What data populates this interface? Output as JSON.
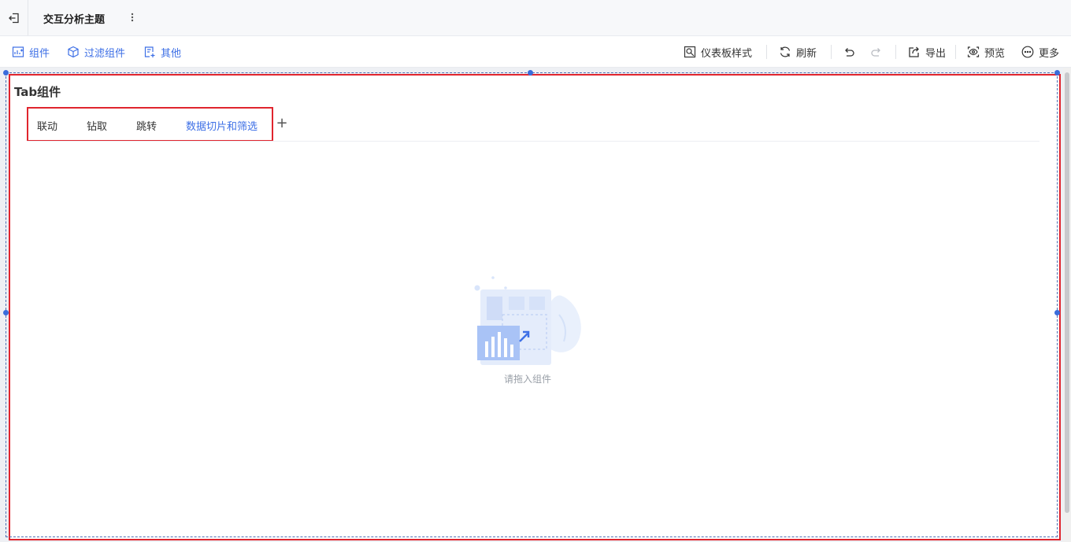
{
  "header": {
    "title": "交互分析主题",
    "back_icon": "exit-icon",
    "more_icon": "vertical-ellipsis-icon"
  },
  "toolbar": {
    "left": [
      {
        "label": "组件",
        "icon": "chart-add-icon"
      },
      {
        "label": "过滤组件",
        "icon": "filter-cube-icon"
      },
      {
        "label": "其他",
        "icon": "document-add-icon"
      }
    ],
    "right": [
      {
        "label": "仪表板样式",
        "icon": "dashboard-style-icon"
      },
      {
        "label": "刷新",
        "icon": "refresh-icon"
      },
      {
        "label": "导出",
        "icon": "export-icon"
      },
      {
        "label": "预览",
        "icon": "preview-icon"
      },
      {
        "label": "更多",
        "icon": "more-circle-icon"
      }
    ],
    "undo_icon": "undo-icon",
    "redo_icon": "redo-icon"
  },
  "component": {
    "title": "Tab组件",
    "tabs": [
      {
        "label": "联动",
        "active": false
      },
      {
        "label": "钻取",
        "active": false
      },
      {
        "label": "跳转",
        "active": false
      },
      {
        "label": "数据切片和筛选",
        "active": true
      }
    ],
    "add_label": "+",
    "empty_text": "请拖入组件"
  },
  "colors": {
    "accent": "#3d6fe6",
    "highlight": "#e0252e",
    "handle": "#3a6cdb"
  }
}
